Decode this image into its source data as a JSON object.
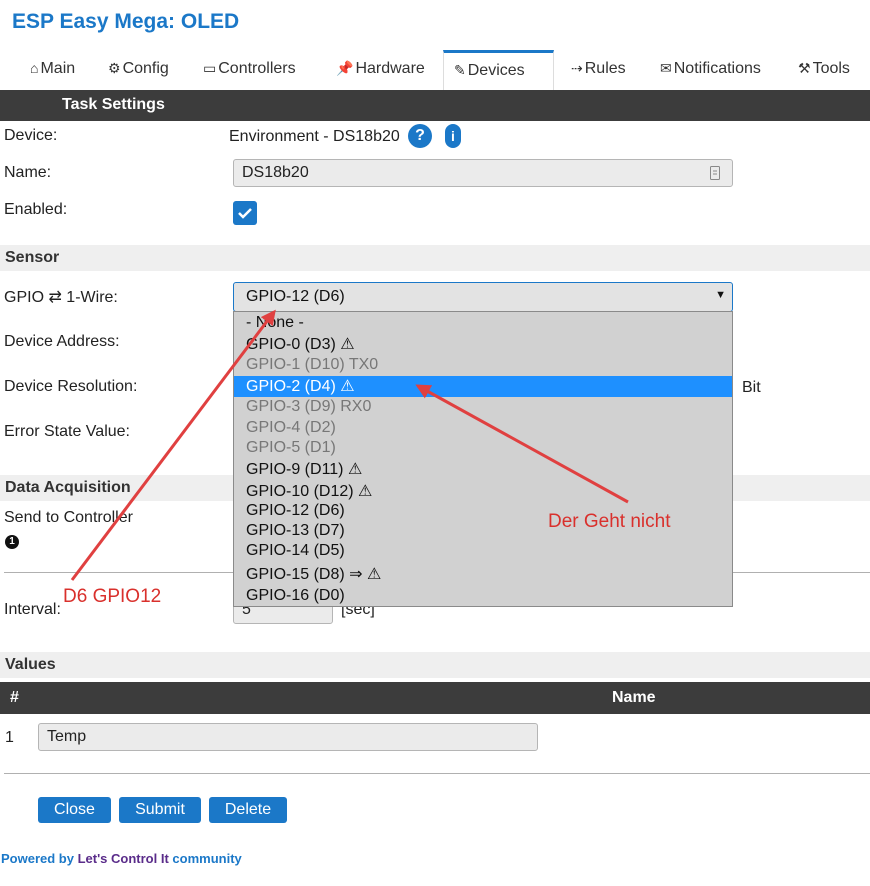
{
  "header": {
    "title": "ESP Easy Mega: OLED"
  },
  "nav": {
    "tabs": [
      {
        "label": "Main",
        "icon": "home-icon"
      },
      {
        "label": "Config",
        "icon": "gear-icon"
      },
      {
        "label": "Controllers",
        "icon": "chat-icon"
      },
      {
        "label": "Hardware",
        "icon": "pin-icon"
      },
      {
        "label": "Devices",
        "icon": "plug-icon"
      },
      {
        "label": "Rules",
        "icon": "arrow-right-icon"
      },
      {
        "label": "Notifications",
        "icon": "mail-icon"
      },
      {
        "label": "Tools",
        "icon": "wrench-icon"
      }
    ],
    "active": "Devices"
  },
  "task": {
    "section_title": "Task Settings",
    "device_label": "Device:",
    "device_value": "Environment - DS18b20",
    "help_symbol": "?",
    "info_symbol": "i",
    "name_label": "Name:",
    "name_value": "DS18b20",
    "enabled_label": "Enabled:",
    "enabled": true
  },
  "sensor": {
    "section_title": "Sensor",
    "gpio_label": "GPIO ⇄ 1-Wire:",
    "gpio_selected": "GPIO-12 (D6)",
    "device_address_label": "Device Address:",
    "device_resolution_label": "Device Resolution:",
    "resolution_unit": "Bit",
    "error_state_label": "Error State Value:"
  },
  "dropdown": {
    "options": [
      {
        "label": "- None -",
        "state": "normal"
      },
      {
        "label": "GPIO-0 (D3) ⚠",
        "state": "normal"
      },
      {
        "label": "GPIO-1 (D10) TX0",
        "state": "disabled"
      },
      {
        "label": "GPIO-2 (D4) ⚠",
        "state": "selected"
      },
      {
        "label": "GPIO-3 (D9) RX0",
        "state": "disabled"
      },
      {
        "label": "GPIO-4 (D2)",
        "state": "disabled"
      },
      {
        "label": "GPIO-5 (D1)",
        "state": "disabled"
      },
      {
        "label": "GPIO-9 (D11) ⚠",
        "state": "normal"
      },
      {
        "label": "GPIO-10 (D12) ⚠",
        "state": "normal"
      },
      {
        "label": "GPIO-12 (D6)",
        "state": "normal"
      },
      {
        "label": "GPIO-13 (D7)",
        "state": "normal"
      },
      {
        "label": "GPIO-14 (D5)",
        "state": "normal"
      },
      {
        "label": "GPIO-15 (D8) ⇒ ⚠",
        "state": "normal"
      },
      {
        "label": "GPIO-16 (D0)",
        "state": "normal"
      }
    ]
  },
  "acquisition": {
    "section_title": "Data Acquisition",
    "send_label": "Send to Controller",
    "send_number": "1",
    "interval_label": "Interval:",
    "interval_value": "5",
    "interval_unit": "[sec]"
  },
  "values": {
    "section_title": "Values",
    "col_number": "#",
    "col_name": "Name",
    "rows": [
      {
        "number": "1",
        "name": "Temp"
      }
    ]
  },
  "buttons": {
    "close": "Close",
    "submit": "Submit",
    "delete": "Delete"
  },
  "footer": {
    "powered_by": "Powered by",
    "brand": "Let's Control It",
    "community": "community"
  },
  "annotations": {
    "d6_label": "D6 GPIO12",
    "not_working_label": "Der Geht nicht",
    "arrow_color": "#e04040"
  },
  "colors": {
    "accent": "#1b78c8",
    "selected": "#1e90ff",
    "dark_bar": "#3c3c3c"
  }
}
